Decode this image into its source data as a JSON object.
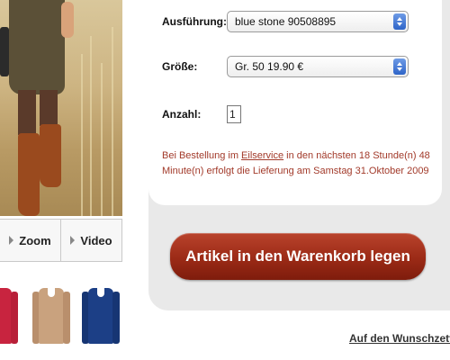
{
  "media": {
    "zoom_label": "Zoom",
    "video_label": "Video"
  },
  "thumbnails": [
    {
      "color": "#c8243f",
      "name": "red"
    },
    {
      "color": "#c9a27e",
      "name": "beige"
    },
    {
      "color": "#1c3f86",
      "name": "navy"
    }
  ],
  "options": {
    "variant_label": "Ausführung:",
    "variant_value": "blue stone 90508895",
    "size_label": "Größe:",
    "size_value": "Gr. 50 19.90 €",
    "quantity_label": "Anzahl:",
    "quantity_value": "1"
  },
  "delivery": {
    "prefix": "Bei Bestellung im ",
    "link": "Eilservice",
    "suffix": " in den nächsten 18 Stunde(n) 48 Minute(n) erfolgt die Lieferung am Samstag 31.Oktober 2009"
  },
  "cart_button_label": "Artikel in den Warenkorb legen",
  "wishlist_label": "Auf den Wunschzettel",
  "colors": {
    "accent": "#9b2a16",
    "delivery_text": "#a23a2a"
  }
}
